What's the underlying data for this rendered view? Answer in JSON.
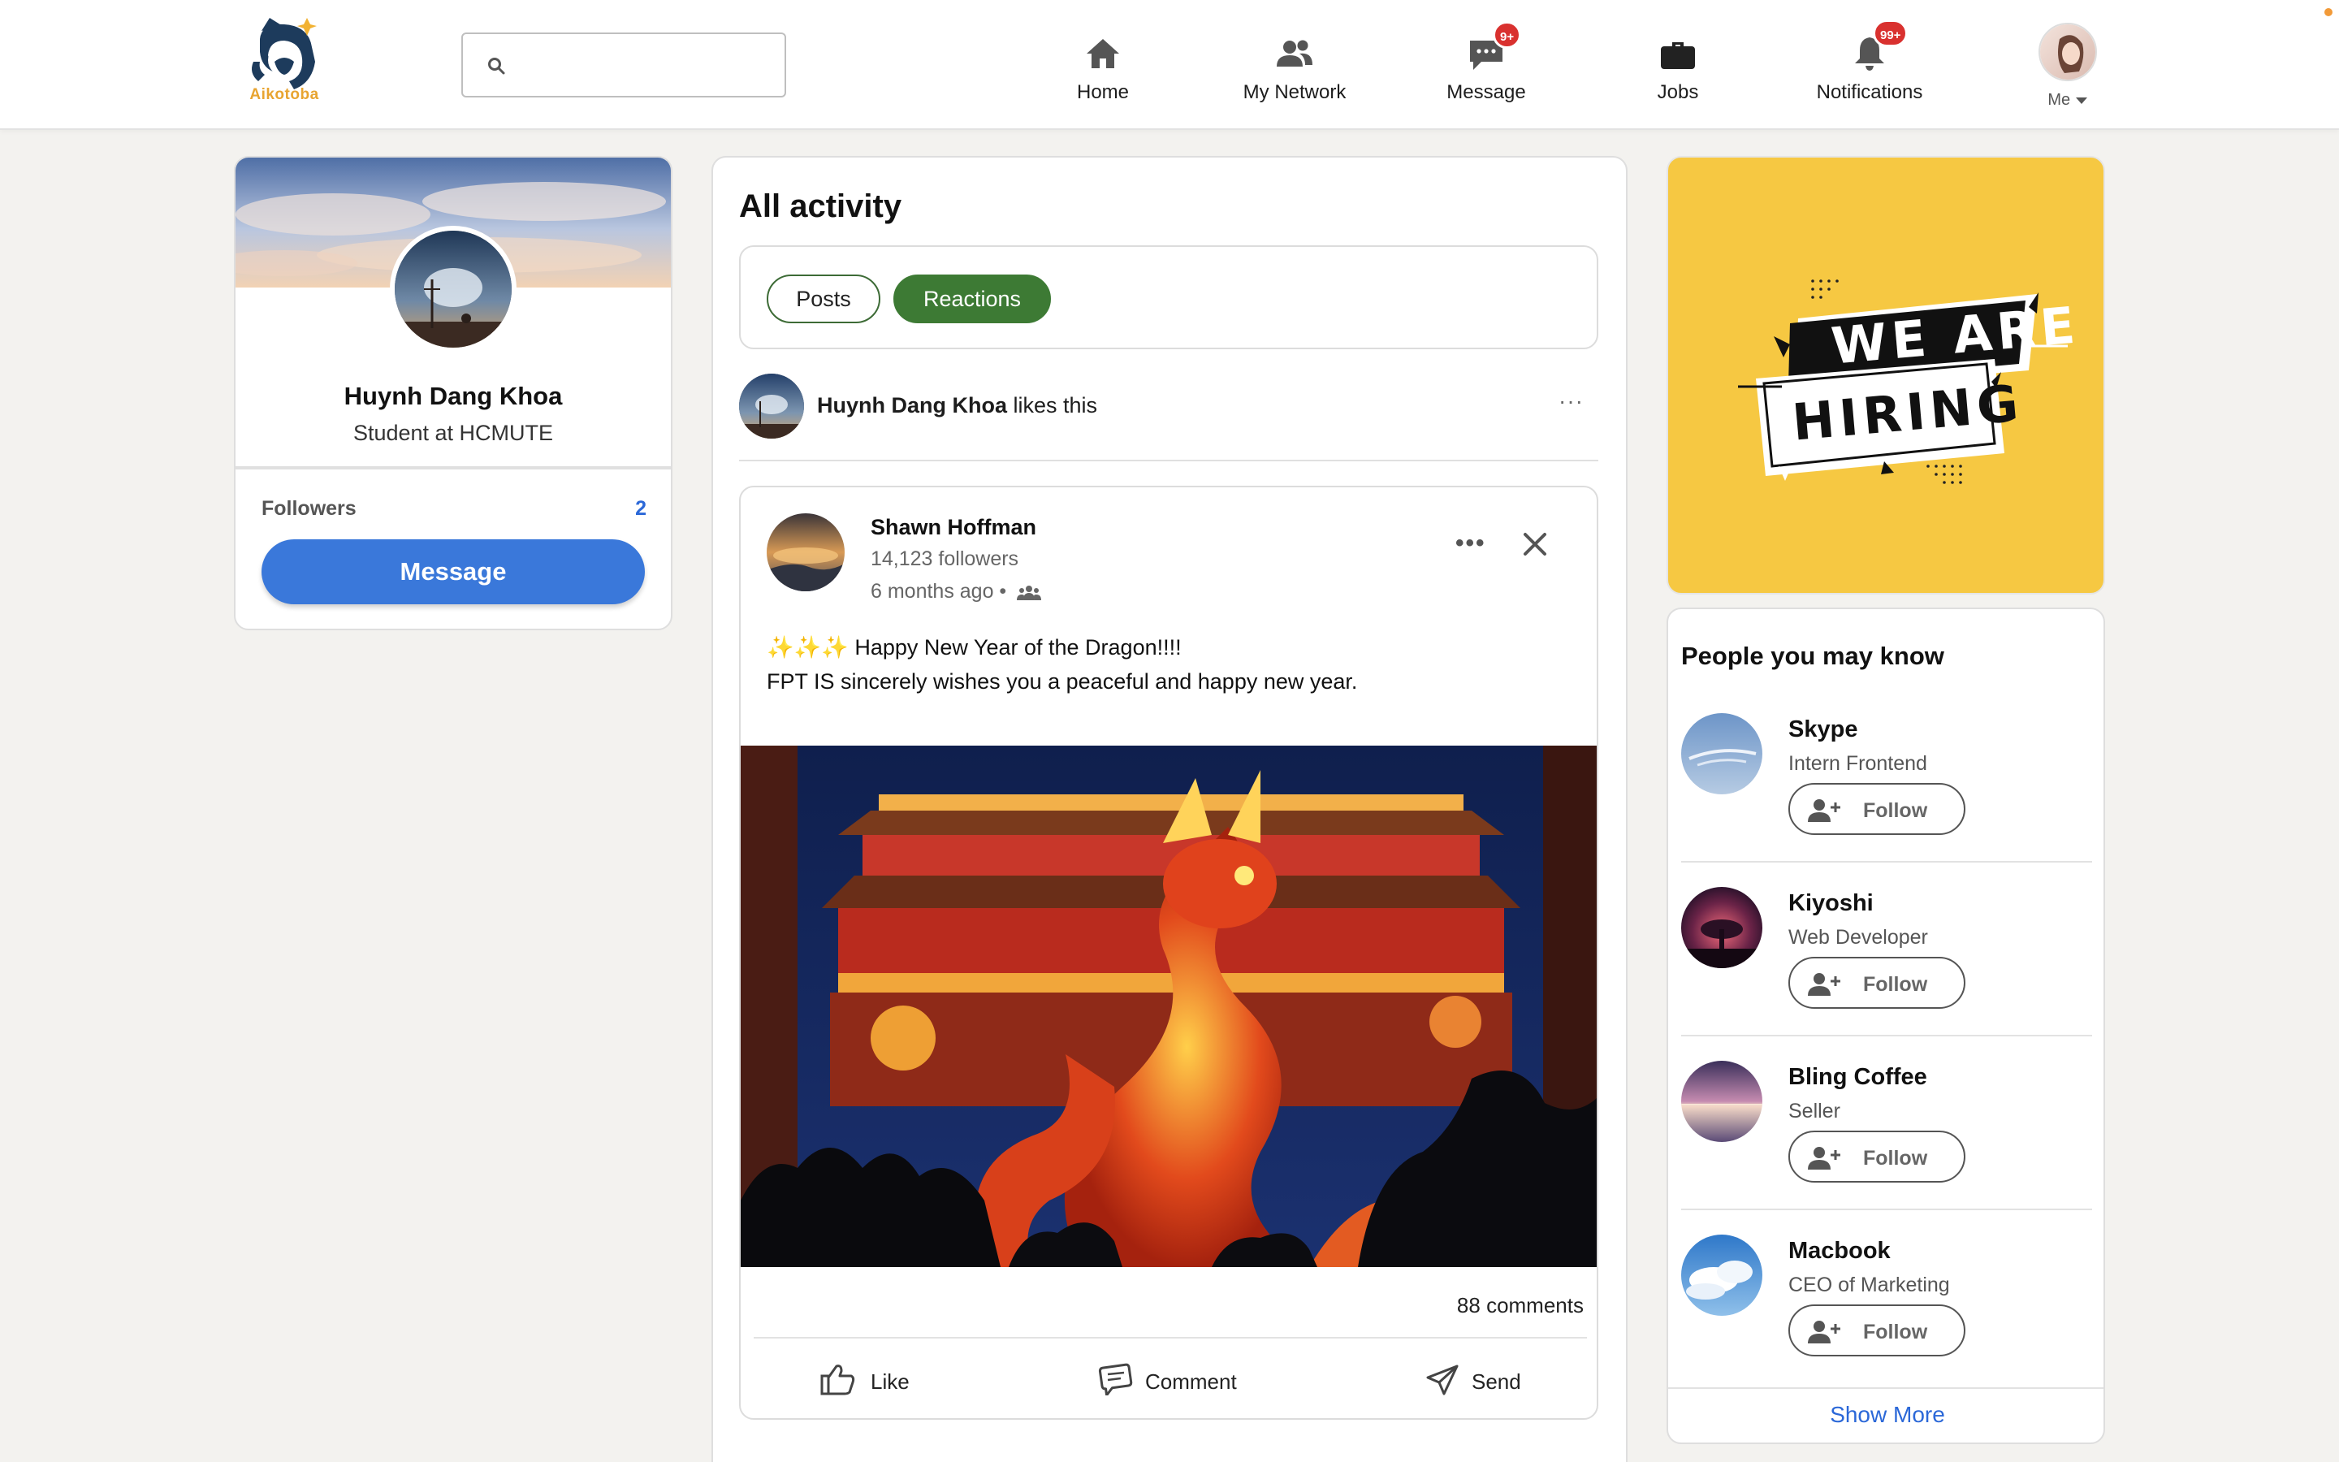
{
  "brand": {
    "name": "Aikotoba"
  },
  "search": {
    "placeholder": "",
    "value": ""
  },
  "nav": {
    "items": [
      {
        "label": "Home",
        "icon": "home-icon"
      },
      {
        "label": "My Network",
        "icon": "network-icon"
      },
      {
        "label": "Message",
        "icon": "message-icon",
        "badge": "9+"
      },
      {
        "label": "Jobs",
        "icon": "briefcase-icon"
      },
      {
        "label": "Notifications",
        "icon": "bell-icon",
        "badge": "99+"
      }
    ],
    "me_label": "Me"
  },
  "profile": {
    "name": "Huynh Dang Khoa",
    "headline": "Student at HCMUTE",
    "followers_label": "Followers",
    "followers_count": "2",
    "message_button": "Message"
  },
  "feed": {
    "title": "All activity",
    "tabs": [
      {
        "label": "Posts",
        "active": false
      },
      {
        "label": "Reactions",
        "active": true
      }
    ],
    "activity": {
      "actor": "Huynh Dang Khoa",
      "action": "likes this",
      "more": "···"
    },
    "post": {
      "author": "Shawn Hoffman",
      "followers": "14,123 followers",
      "time": "6 months ago •",
      "line1": "✨✨✨ Happy New Year of the Dragon!!!!",
      "line2": "FPT IS sincerely wishes you a peaceful and happy new year.",
      "comments": "88 comments",
      "actions": {
        "like": "Like",
        "comment": "Comment",
        "send": "Send"
      }
    }
  },
  "ad": {
    "line1": "WE ARE",
    "line2": "HIRING",
    "background": "#f6c842"
  },
  "people": {
    "title": "People you may know",
    "follow_label": "Follow",
    "items": [
      {
        "name": "Skype",
        "role": "Intern Frontend"
      },
      {
        "name": "Kiyoshi",
        "role": "Web Developer"
      },
      {
        "name": "Bling Coffee",
        "role": "Seller"
      },
      {
        "name": "Macbook",
        "role": "CEO of Marketing"
      }
    ],
    "show_more": "Show More"
  },
  "colors": {
    "accent_blue": "#3a78da",
    "reaction_green": "#3d7a34",
    "badge_red": "#d9312f",
    "page_bg": "#f3f2ef"
  }
}
